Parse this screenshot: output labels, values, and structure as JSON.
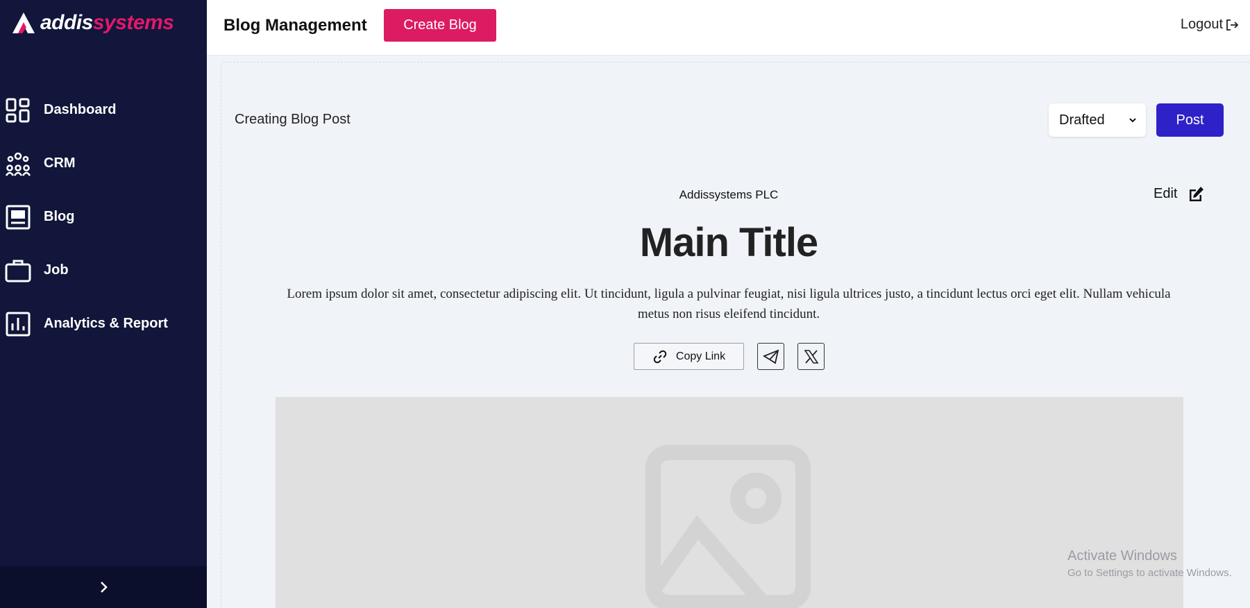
{
  "brand": {
    "name_part1": "addis",
    "name_part2": "systems",
    "accent_color": "#dc1b62",
    "sidebar_color": "#11163a"
  },
  "sidebar": {
    "items": [
      {
        "label": "Dashboard",
        "icon": "dashboard-icon"
      },
      {
        "label": "CRM",
        "icon": "people-group-icon"
      },
      {
        "label": "Blog",
        "icon": "blog-icon"
      },
      {
        "label": "Job",
        "icon": "briefcase-icon"
      },
      {
        "label": "Analytics & Report",
        "icon": "bar-chart-icon"
      }
    ],
    "expand_icon": "chevron-right-icon"
  },
  "header": {
    "title": "Blog Management",
    "create_button": "Create Blog",
    "logout": "Logout"
  },
  "editor": {
    "heading": "Creating Blog Post",
    "status_value": "Drafted",
    "post_button": "Post",
    "post_button_color": "#2e21c8"
  },
  "preview": {
    "organization": "Addissystems PLC",
    "edit_label": "Edit",
    "title": "Main Title",
    "body": "Lorem ipsum dolor sit amet, consectetur adipiscing elit. Ut tincidunt, ligula a pulvinar feugiat, nisi ligula ultrices justo, a tincidunt lectus orci eget elit. Nullam vehicula metus non risus eleifend tincidunt.",
    "copy_link": "Copy Link",
    "share_icons": [
      "telegram-icon",
      "x-twitter-icon"
    ],
    "image_placeholder_icon": "image-placeholder-icon"
  },
  "watermark": {
    "line1": "Activate Windows",
    "line2": "Go to Settings to activate Windows."
  }
}
